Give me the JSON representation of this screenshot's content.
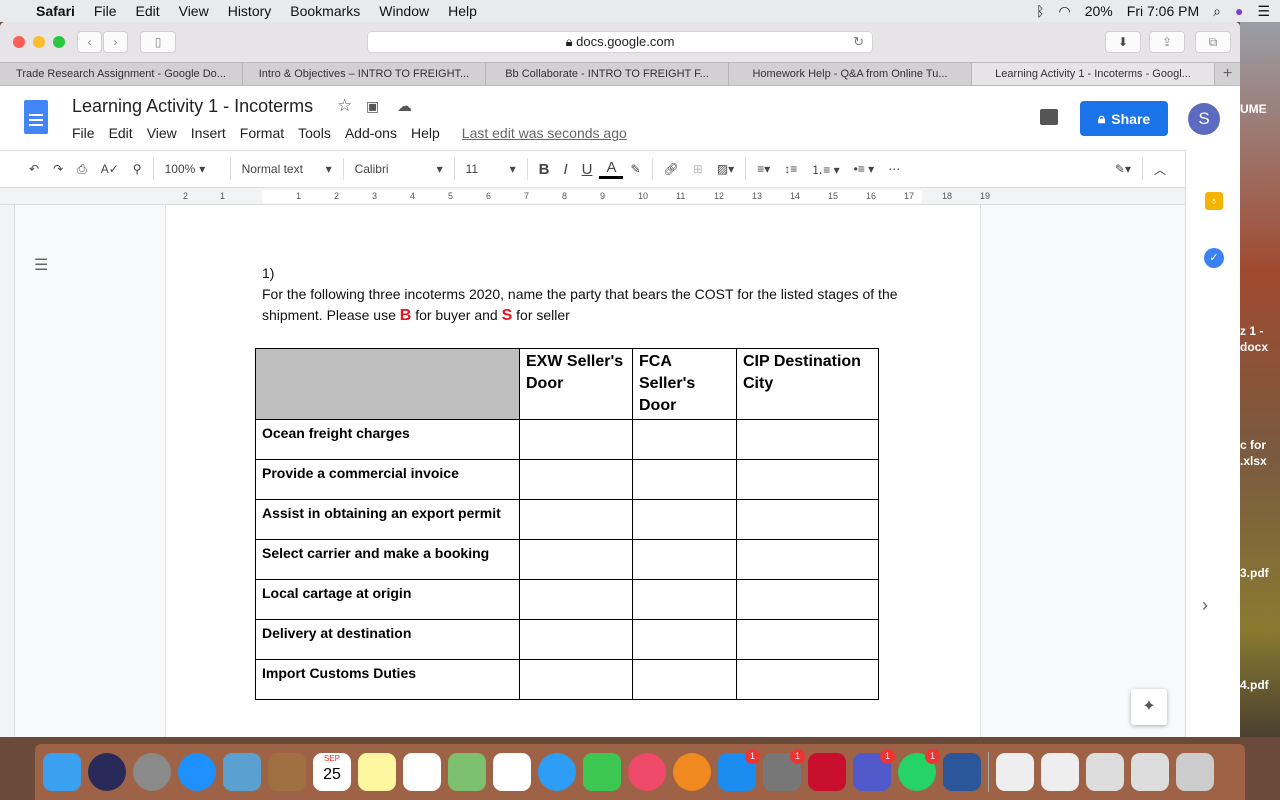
{
  "menubar": {
    "app": "Safari",
    "items": [
      "File",
      "Edit",
      "View",
      "History",
      "Bookmarks",
      "Window",
      "Help"
    ],
    "battery": "20%",
    "clock": "Fri 7:06 PM"
  },
  "browser": {
    "url": "docs.google.com",
    "tabs": [
      {
        "label": "Trade Research Assignment - Google Do...",
        "active": false
      },
      {
        "label": "Intro & Objectives – INTRO TO FREIGHT...",
        "active": false
      },
      {
        "label": "Bb Collaborate - INTRO TO FREIGHT F...",
        "active": false
      },
      {
        "label": "Homework Help - Q&A from Online Tu...",
        "active": false
      },
      {
        "label": "Learning Activity 1 - Incoterms - Googl...",
        "active": true
      }
    ]
  },
  "docs": {
    "title": "Learning Activity 1 - Incoterms",
    "menus": [
      "File",
      "Edit",
      "View",
      "Insert",
      "Format",
      "Tools",
      "Add-ons",
      "Help"
    ],
    "last_edit": "Last edit was seconds ago",
    "share_label": "Share",
    "avatar_letter": "S",
    "accent": "#1a73e8"
  },
  "toolbar": {
    "zoom": "100%",
    "style": "Normal text",
    "font": "Calibri",
    "size": "11"
  },
  "ruler": {
    "labels": [
      "2",
      "1",
      "1",
      "2",
      "3",
      "4",
      "5",
      "6",
      "7",
      "8",
      "9",
      "10",
      "11",
      "12",
      "13",
      "14",
      "15",
      "16",
      "17",
      "18",
      "19"
    ]
  },
  "document": {
    "number": "1)",
    "para1": "For the following three incoterms 2020, name the party that bears the COST for the listed stages of the shipment.  Please use ",
    "b": "B",
    "mid": " for buyer and ",
    "s": "S",
    "end": " for seller",
    "table": {
      "headers": [
        "",
        "EXW Seller's Door",
        "FCA Seller's Door",
        "CIP Destination City"
      ],
      "rows": [
        "Ocean freight charges",
        " Provide a commercial invoice",
        "Assist in obtaining an export permit",
        "Select carrier and make a booking",
        "Local cartage at origin",
        "Delivery at destination",
        "Import Customs Duties"
      ]
    }
  },
  "desktop": {
    "files": [
      "z 1 -",
      "docx",
      "c for",
      ".xlsx",
      "3.pdf",
      "4.pdf"
    ],
    "ume": "UME"
  },
  "dock": {
    "calendar_month": "SEP",
    "calendar_day": "25",
    "badges": {
      "appstore": "1",
      "prefs": "1",
      "teams": "1",
      "whatsapp": "1"
    }
  }
}
